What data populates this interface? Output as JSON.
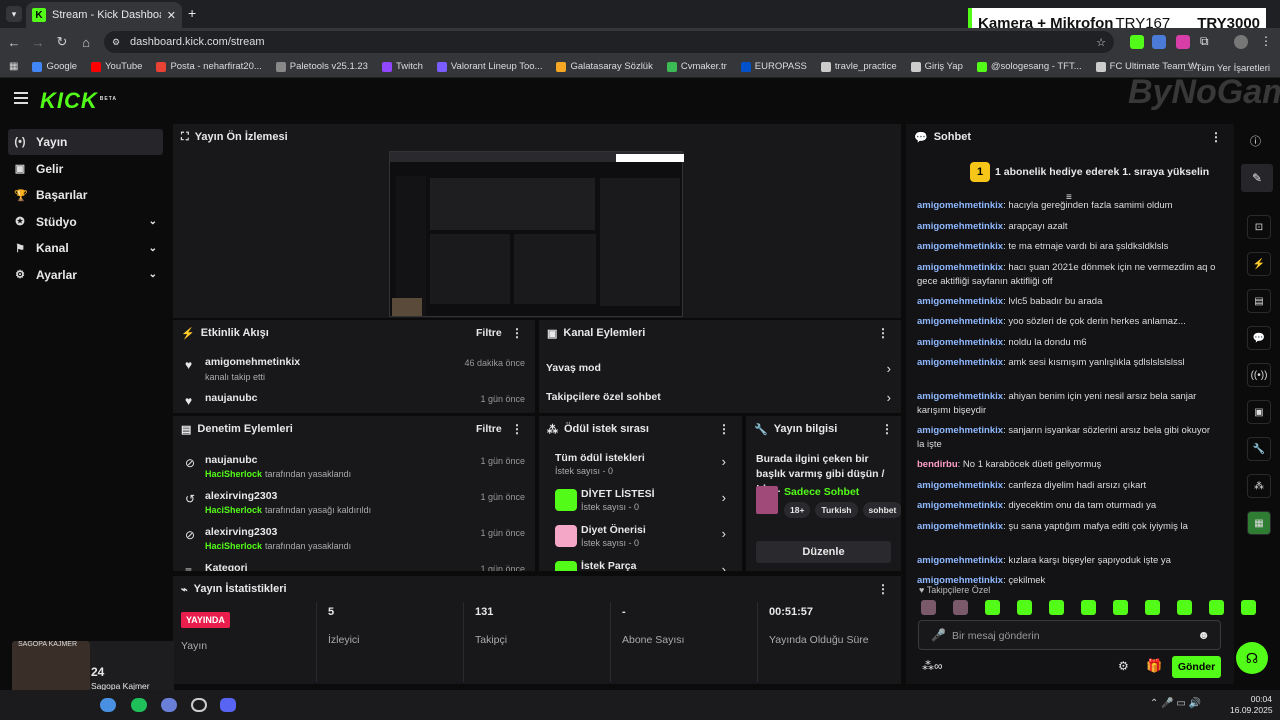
{
  "browser": {
    "tab_title": "Stream - Kick Dashboard",
    "url": "dashboard.kick.com/stream",
    "bookmarks": [
      "Google",
      "YouTube",
      "Posta - neharfirat20...",
      "Paletools v25.1.23",
      "Twitch",
      "Valorant Lineup Too...",
      "Galatasaray Sözlük",
      "Cvmaker.tr",
      "EUROPASS",
      "travle_practice",
      "Giriş Yap",
      "@sologesang - TFT...",
      "FC Ultimate Team W..."
    ],
    "all_bookmarks": "Tüm Yer İşaretleri"
  },
  "overlay": {
    "text1": "Kamera + Mikrofon",
    "text2": "TRY167",
    "text3": "TRY3000",
    "watermark": "ByNoGame"
  },
  "kick": {
    "logo": "KICK",
    "beta": "BETA"
  },
  "sidebar": {
    "items": [
      {
        "label": "Yayın",
        "icon": "broadcast-icon"
      },
      {
        "label": "Gelir",
        "icon": "wallet-icon"
      },
      {
        "label": "Başarılar",
        "icon": "trophy-icon"
      },
      {
        "label": "Stüdyo",
        "icon": "studio-icon"
      },
      {
        "label": "Kanal",
        "icon": "channel-icon"
      },
      {
        "label": "Ayarlar",
        "icon": "gear-icon"
      }
    ]
  },
  "preview": {
    "title": "Yayın Ön İzlemesi"
  },
  "activity": {
    "title": "Etkinlik Akışı",
    "filter": "Filtre",
    "items": [
      {
        "user": "amigomehmetinkix",
        "text": "kanalı takip etti",
        "time": "46 dakika önce"
      },
      {
        "user": "naujanubc",
        "text": "",
        "time": "1 gün önce"
      }
    ]
  },
  "channel_actions": {
    "title": "Kanal Eylemleri",
    "items": [
      "Yavaş mod",
      "Takipçilere özel sohbet"
    ]
  },
  "moderation": {
    "title": "Denetim Eylemleri",
    "filter": "Filtre",
    "items": [
      {
        "user": "naujanubc",
        "mod": "HaciSherlock",
        "action": "tarafından yasaklandı",
        "time": "1 gün önce"
      },
      {
        "user": "alexirving2303",
        "mod": "HaciSherlock",
        "action": "tarafından yasağı kaldırıldı",
        "time": "1 gün önce"
      },
      {
        "user": "alexirving2303",
        "mod": "HaciSherlock",
        "action": "tarafından yasaklandı",
        "time": "1 gün önce"
      },
      {
        "user": "Kategori",
        "mod": "",
        "action": "",
        "time": "1 gün önce"
      }
    ]
  },
  "rewards": {
    "title": "Ödül istek sırası",
    "items": [
      {
        "name": "Tüm ödül istekleri",
        "count": "İstek sayısı - 0"
      },
      {
        "name": "DİYET LİSTESİ",
        "count": "İstek sayısı - 0"
      },
      {
        "name": "Diyet Önerisi",
        "count": "İstek sayısı - 0"
      },
      {
        "name": "İstek Parça",
        "count": ""
      }
    ]
  },
  "stream_info": {
    "title": "Yayın bilgisi",
    "stream_title": "Burada ilgini çeken bir başlık varmış gibi düşün / !dc...",
    "category": "Sadece Sohbet",
    "tags": [
      "18+",
      "Turkish",
      "sohbet"
    ],
    "edit": "Düzenle"
  },
  "stats": {
    "title": "Yayın İstatistikleri",
    "live_badge": "YAYINDA",
    "items": [
      {
        "value": "",
        "label": "Yayın"
      },
      {
        "value": "5",
        "label": "İzleyici"
      },
      {
        "value": "131",
        "label": "Takipçi"
      },
      {
        "value": "-",
        "label": "Abone Sayısı"
      },
      {
        "value": "00:51:57",
        "label": "Yayında Olduğu Süre"
      }
    ]
  },
  "chat": {
    "title": "Sohbet",
    "pinned": "1 abonelik hediye ederek 1. sıraya yükselin",
    "pinned_rank": "1",
    "messages": [
      {
        "user": "amigomehmetinkix",
        "text": "hacıyla gereğinden fazla samimi oldum"
      },
      {
        "user": "amigomehmetinkix",
        "text": "arapçayı azalt"
      },
      {
        "user": "amigomehmetinkix",
        "text": "te ma etmaje vardı bi ara şsldksldklsls"
      },
      {
        "user": "amigomehmetinkix",
        "text": "hacı şuan 2021e dönmek için ne vermezdim aq o gece aktifliği sayfanın aktifliği off"
      },
      {
        "user": "amigomehmetinkix",
        "text": "lvlc5 babadır bu arada"
      },
      {
        "user": "amigomehmetinkix",
        "text": "yoo sözleri de çok derin herkes anlamaz..."
      },
      {
        "user": "amigomehmetinkix",
        "text": "noldu la dondu m6"
      },
      {
        "user": "amigomehmetinkix",
        "text": "amk sesi kısmışım yanlışlıkla şdlslslslslssl"
      },
      {
        "user": "amigomehmetinkix",
        "text": "ahiyan benim için yeni nesil arsız bela sanjar karışımı bişeydir"
      },
      {
        "user": "amigomehmetinkix",
        "text": "sanjarın isyankar sözlerini arsız bela gibi okuyor la işte"
      },
      {
        "user": "bendirbu",
        "text": "No 1 karaböcek düeti geliyormuş"
      },
      {
        "user": "amigomehmetinkix",
        "text": "canfeza diyelim hadi arsızı çıkart"
      },
      {
        "user": "amigomehmetinkix",
        "text": "diyecektim onu da tam oturmadı ya"
      },
      {
        "user": "amigomehmetinkix",
        "text": "şu sana yaptığım mafya editi çok iyiymiş la"
      },
      {
        "user": "amigomehmetinkix",
        "text": "kızlara karşı bişeyler şapıyoduk işte ya"
      },
      {
        "user": "amigomehmetinkix",
        "text": "çekilmek"
      }
    ],
    "followers_only": "Takipçilere Özel",
    "placeholder": "Bir mesaj gönderin",
    "send": "Gönder"
  },
  "webcam": {
    "viewers": "24",
    "name": "Sagopa Kajmer",
    "label": "SAGOPA KAJMER"
  },
  "taskbar": {
    "time": "00:04",
    "date": "16.09.2025"
  },
  "colors": {
    "accent": "#53fc18",
    "bg": "#0b0b0c",
    "panel": "#18181b",
    "live": "#e91e4d"
  }
}
